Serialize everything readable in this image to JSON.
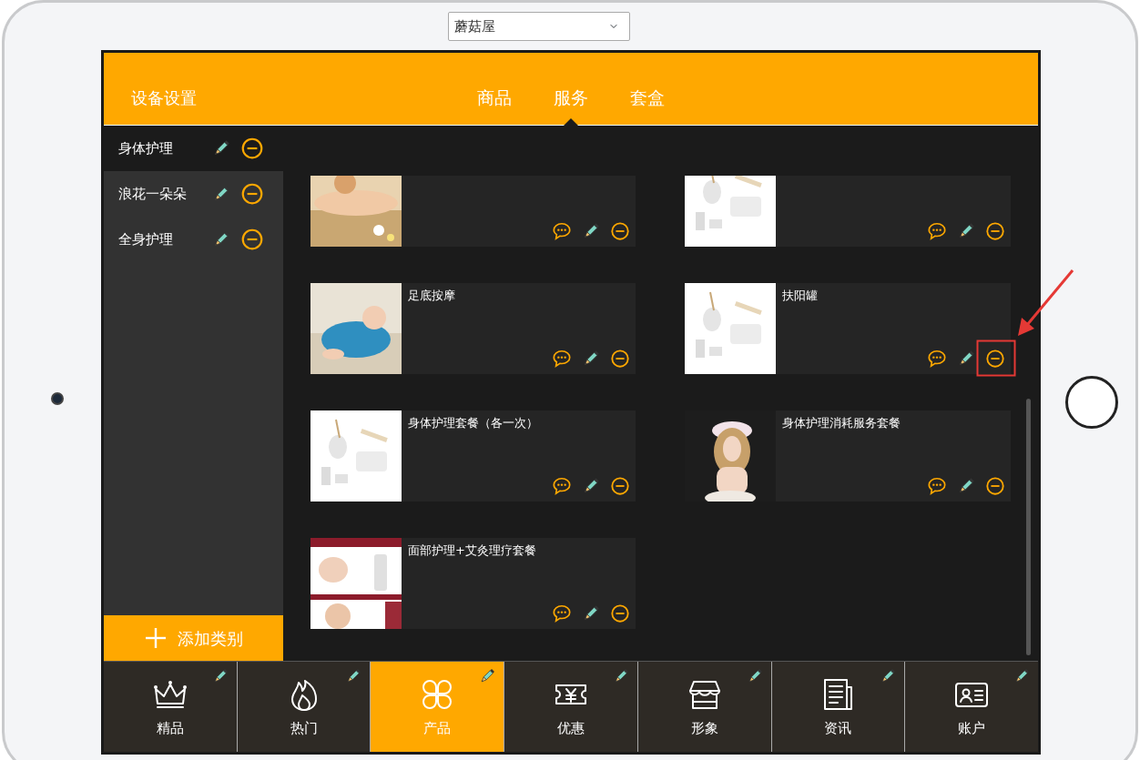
{
  "store_select": {
    "value": "蘑菇屋"
  },
  "header": {
    "title": "设备设置",
    "tabs": [
      {
        "label": "商品",
        "selected": false
      },
      {
        "label": "服务",
        "selected": true
      },
      {
        "label": "套盒",
        "selected": false
      }
    ]
  },
  "sidebar": {
    "items": [
      {
        "label": "身体护理",
        "selected": true
      },
      {
        "label": "浪花一朵朵",
        "selected": false
      },
      {
        "label": "全身护理",
        "selected": false
      }
    ],
    "add_button": "添加类别"
  },
  "services": [
    {
      "picture": {
        "kind": "picture"
      }
    },
    {
      "picture": {
        "kind": "picture"
      }
    },
    {
      "title": "足底按摩",
      "picture": {
        "kind": "picture"
      }
    },
    {
      "title": "扶阳罐",
      "picture": {
        "kind": "picture"
      }
    },
    {
      "title": "身体护理套餐（各一次）",
      "picture": {
        "kind": "picture"
      }
    },
    {
      "title": "身体护理消耗服务套餐",
      "picture": {
        "kind": "picture"
      }
    },
    {
      "title": "面部护理+艾灸理疗套餐",
      "picture": {
        "kind": "picture"
      }
    }
  ],
  "bottom_tabs": [
    {
      "label": "精品",
      "selected": false
    },
    {
      "label": "热门",
      "selected": false
    },
    {
      "label": "产品",
      "selected": true
    },
    {
      "label": "优惠",
      "selected": false
    },
    {
      "label": "形象",
      "selected": false
    },
    {
      "label": "资讯",
      "selected": false
    },
    {
      "label": "账户",
      "selected": false
    }
  ]
}
